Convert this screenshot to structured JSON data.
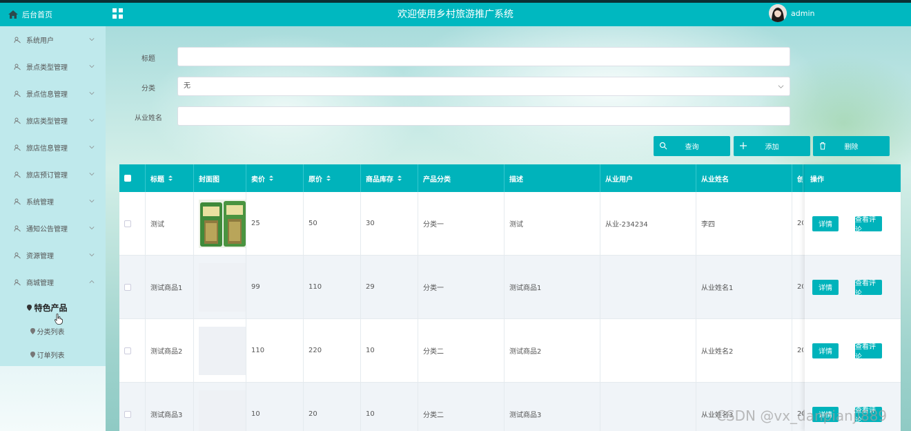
{
  "header": {
    "home_label": "后台首页",
    "site_title": "欢迎使用乡村旅游推广系统",
    "username": "admin"
  },
  "sidebar": {
    "items": [
      {
        "label": "系统用户"
      },
      {
        "label": "景点类型管理"
      },
      {
        "label": "景点信息管理"
      },
      {
        "label": "旅店类型管理"
      },
      {
        "label": "旅店信息管理"
      },
      {
        "label": "旅店预订管理"
      },
      {
        "label": "系统管理"
      },
      {
        "label": "通知公告管理"
      },
      {
        "label": "资源管理"
      },
      {
        "label": "商城管理"
      }
    ],
    "submenu": [
      {
        "label": "特色产品",
        "active": true
      },
      {
        "label": "分类列表"
      },
      {
        "label": "订单列表"
      }
    ]
  },
  "search": {
    "title_label": "标题",
    "category_label": "分类",
    "category_value": "无",
    "worker_label": "从业姓名",
    "title_value": "",
    "worker_value": ""
  },
  "buttons": {
    "query": "查询",
    "add": "添加",
    "delete": "删除"
  },
  "table": {
    "headers": [
      "标题",
      "封面图",
      "卖价",
      "原价",
      "商品库存",
      "产品分类",
      "描述",
      "从业用户",
      "从业姓名",
      "创"
    ],
    "operation_header": "操作",
    "rows": [
      {
        "title": "测试",
        "price": "25",
        "original": "50",
        "stock": "30",
        "category": "分类一",
        "desc": "测试",
        "user": "从业-234234",
        "name": "李四",
        "created": "20"
      },
      {
        "title": "测试商品1",
        "price": "99",
        "original": "110",
        "stock": "29",
        "category": "分类一",
        "desc": "测试商品1",
        "user": "",
        "name": "从业姓名1",
        "created": "20"
      },
      {
        "title": "测试商品2",
        "price": "110",
        "original": "220",
        "stock": "10",
        "category": "分类二",
        "desc": "测试商品2",
        "user": "",
        "name": "从业姓名2",
        "created": "20"
      },
      {
        "title": "测试商品3",
        "price": "10",
        "original": "20",
        "stock": "10",
        "category": "分类二",
        "desc": "测试商品3",
        "user": "",
        "name": "从业姓名3",
        "created": "20"
      }
    ],
    "detail_label": "详情",
    "review_label": "查看评论"
  },
  "watermark": "CSDN @vx_danpianji889",
  "colors": {
    "accent": "#00b3bb",
    "header": "#00b8c0",
    "sidebar": "#bfe9ec"
  }
}
